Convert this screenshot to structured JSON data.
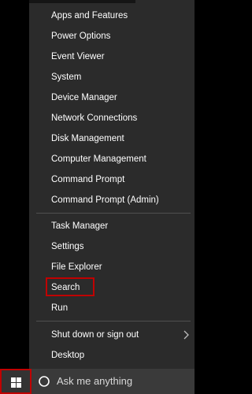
{
  "menu": {
    "group1": [
      "Apps and Features",
      "Power Options",
      "Event Viewer",
      "System",
      "Device Manager",
      "Network Connections",
      "Disk Management",
      "Computer Management",
      "Command Prompt",
      "Command Prompt (Admin)"
    ],
    "group2": [
      "Task Manager",
      "Settings",
      "File Explorer",
      "Search",
      "Run"
    ],
    "group3": [
      "Shut down or sign out",
      "Desktop"
    ],
    "highlighted_item": "Search",
    "submenu_icon": "chevron-right-icon"
  },
  "taskbar": {
    "start_icon": "windows-logo-icon",
    "search_icon": "cortana-circle-icon",
    "search_text": "Ask me anything"
  },
  "colors": {
    "menu_background": "#2b2b2b",
    "menu_text": "#ffffff",
    "separator": "#505050",
    "highlight_border": "#c00000",
    "taskbar_background": "#000000",
    "search_background": "#3a3a3a"
  }
}
